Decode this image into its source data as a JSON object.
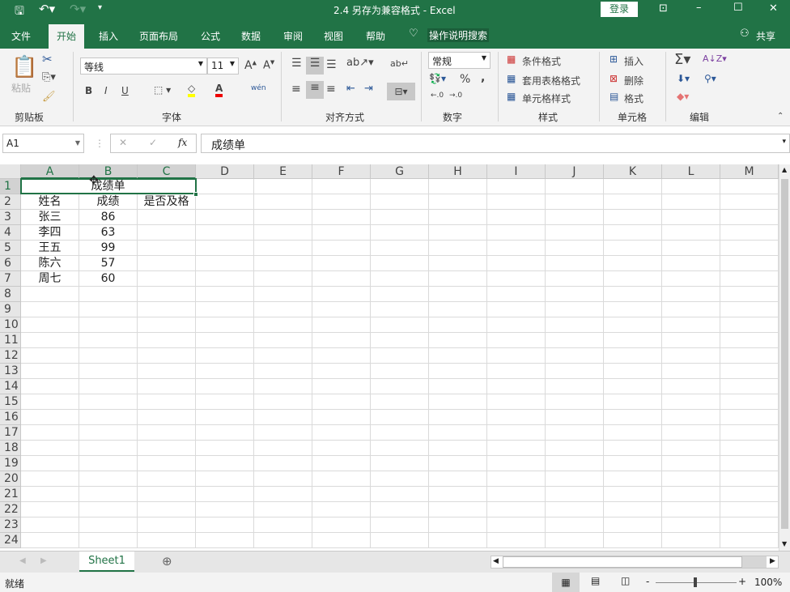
{
  "titlebar": {
    "title": "2.4 另存为兼容格式  -  Excel",
    "login": "登录",
    "qat": [
      "save-icon",
      "undo-icon",
      "redo-icon",
      "customize-icon"
    ]
  },
  "tabs": [
    "文件",
    "开始",
    "插入",
    "页面布局",
    "公式",
    "数据",
    "审阅",
    "视图",
    "帮助"
  ],
  "active_tab": "开始",
  "tell_me": "操作说明搜索",
  "share": "共享",
  "ribbon": {
    "clipboard": {
      "label": "剪贴板",
      "paste": "粘贴"
    },
    "font": {
      "label": "字体",
      "font_name": "等线",
      "font_size": "11",
      "bold": "B",
      "italic": "I",
      "underline": "U",
      "wen": "wén"
    },
    "alignment": {
      "label": "对齐方式"
    },
    "number": {
      "label": "数字",
      "format": "常规",
      "percent": "%",
      "comma": ","
    },
    "styles": {
      "label": "样式",
      "conditional": "条件格式",
      "table": "套用表格格式",
      "cell_styles": "单元格样式"
    },
    "cells": {
      "label": "单元格",
      "insert": "插入",
      "delete": "删除",
      "format": "格式"
    },
    "editing": {
      "label": "编辑"
    }
  },
  "formula_bar": {
    "name_box": "A1",
    "fx": "fx",
    "value": "成绩单"
  },
  "grid": {
    "columns": [
      "A",
      "B",
      "C",
      "D",
      "E",
      "F",
      "G",
      "H",
      "I",
      "J",
      "K",
      "L",
      "M"
    ],
    "rows": 24,
    "merged_title": "成绩单",
    "data": [
      [
        "姓名",
        "成绩",
        "是否及格"
      ],
      [
        "张三",
        "86",
        ""
      ],
      [
        "李四",
        "63",
        ""
      ],
      [
        "王五",
        "99",
        ""
      ],
      [
        "陈六",
        "57",
        ""
      ],
      [
        "周七",
        "60",
        ""
      ]
    ]
  },
  "sheets": [
    "Sheet1"
  ],
  "status": {
    "ready": "就绪",
    "zoom": "100%"
  }
}
